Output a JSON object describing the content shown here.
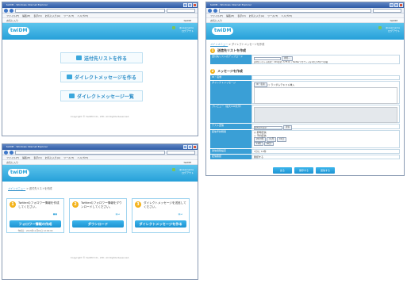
{
  "browser": {
    "title": "twiDM - Windows Internet Explorer",
    "menu_items": [
      "ファイル(F)",
      "編集(E)",
      "表示(V)",
      "お気に入り(A)",
      "ツール(T)",
      "ヘルプ(H)"
    ],
    "favorites_label": "お気に入り",
    "page_title_short": "twiDM"
  },
  "app": {
    "logo": "twiDM",
    "user_info_line1": "@username",
    "user_info_line2": "ログアウト",
    "footer": "Copyright © twiDM CO., LTD. All Rights Reserved."
  },
  "home": {
    "buttons": [
      "送付先リストを作る",
      "ダイレクトメッセージを作る",
      "ダイレクトメッセージ一覧"
    ]
  },
  "list_page": {
    "breadcrumb_home": "メインメニュー",
    "breadcrumb_current": "送付先リストを作成",
    "steps": [
      {
        "num": "1",
        "text": "Twitterのフォロワー情報を作成してください。",
        "button": "フォロワー情報の作成",
        "note": "作成日：2013年11月01日 12:00:00"
      },
      {
        "num": "2",
        "text": "Twitterのフォロワー情報をダウンロードしてください。",
        "button": "ダウンロード",
        "note": ""
      },
      {
        "num": "3",
        "text": "ダイレクトメッセージを送信してください。",
        "button": "ダイレクトメッセージを作る",
        "note": ""
      }
    ]
  },
  "message_page": {
    "breadcrumb_home": "メインメニュー",
    "breadcrumb_current": "ダイレクトメッセージを作成",
    "section1": {
      "num": "1",
      "title": "送信先リストを作成"
    },
    "list_upload": {
      "label": "送付先リストのアップロード",
      "button": "参照...",
      "note": "送付先リストの形式：CSV形式（UTF-8）/ Twitterアカウントを1行に1件ずつ記載"
    },
    "section2": {
      "num": "2",
      "title": "メッセージを作成"
    },
    "fields": {
      "id_label": "ID・名前",
      "message_label": "ダイレクトメッセージ",
      "insert_button": "ID・名前",
      "insert_note": "□ ランダムテキスト挿入",
      "preview_label": "プレビュー（最大140文字）",
      "test_label": "テスト送信",
      "test_value": "@testuser",
      "test_button": "送信",
      "schedule_label": "配信予約時間",
      "schedule_now": "◎ 即時配信",
      "schedule_later": "○ 予約配信",
      "schedule_year": "2013年",
      "schedule_month": "11月",
      "schedule_day": "01日",
      "schedule_hour": "12時",
      "schedule_min": "00分",
      "interval_label": "送信間隔設定",
      "interval_value": "1分に 10件",
      "confirm_label": "配信確認",
      "confirm_value": "確認する"
    },
    "actions": [
      "戻る",
      "保存する",
      "送信する"
    ]
  },
  "colors": {
    "header": "#26a0d9",
    "label_bg": "#3a9fd6",
    "step_num": "#f3b21a"
  }
}
